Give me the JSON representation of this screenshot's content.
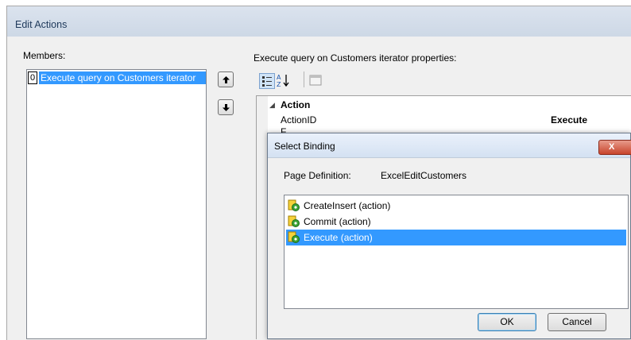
{
  "window": {
    "title": "Edit Actions"
  },
  "members": {
    "label": "Members:",
    "items": [
      {
        "index": "0",
        "text": "Execute query on Customers iterator"
      }
    ]
  },
  "properties": {
    "label": "Execute query on Customers iterator properties:",
    "category": "Action",
    "rows": [
      {
        "name": "ActionID",
        "value": "Execute"
      }
    ],
    "partial_row": "F"
  },
  "dialog": {
    "title": "Select Binding",
    "close": "X",
    "page_definition_label": "Page Definition:",
    "page_definition_value": "ExcelEditCustomers",
    "bindings": [
      {
        "label": "CreateInsert (action)",
        "selected": false
      },
      {
        "label": "Commit (action)",
        "selected": false
      },
      {
        "label": "Execute (action)",
        "selected": true
      }
    ],
    "ok": "OK",
    "cancel": "Cancel"
  },
  "colors": {
    "selection": "#3399ff",
    "title_text": "#1e395b"
  }
}
